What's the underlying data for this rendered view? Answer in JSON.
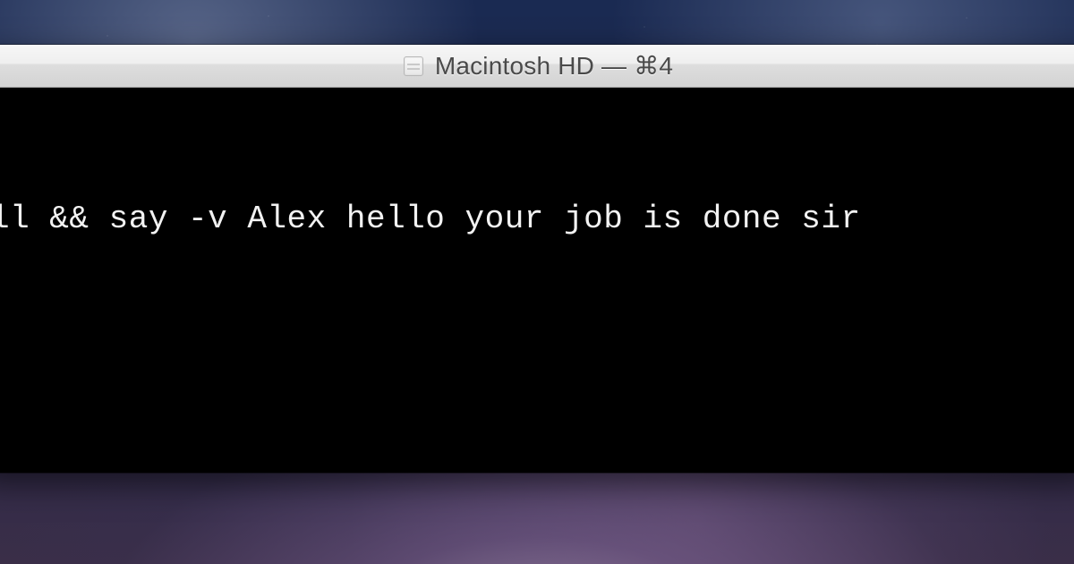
{
  "window": {
    "title": "Macintosh HD — ⌘4",
    "icon": "terminal-proxy-icon"
  },
  "terminal": {
    "visible_line": "ll && say -v Alex hello your job is done sir"
  }
}
